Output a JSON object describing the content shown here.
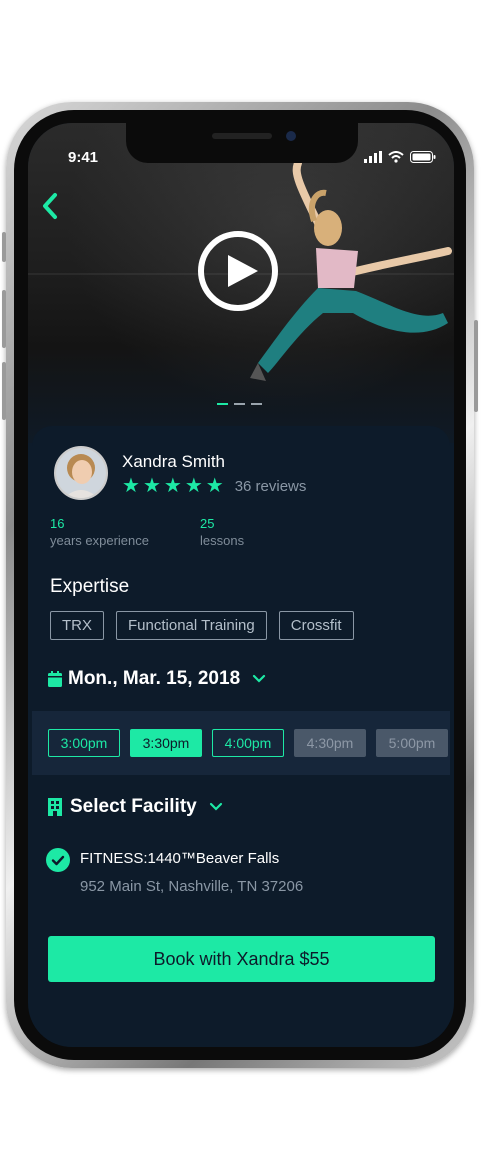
{
  "status_bar": {
    "time": "9:41"
  },
  "hero": {
    "slides": 3,
    "active_slide": 1
  },
  "trainer": {
    "name": "Xandra Smith",
    "rating": 5,
    "reviews_label": "36 reviews",
    "stats": [
      {
        "value": "16",
        "label": "years experience"
      },
      {
        "value": "25",
        "label": "lessons"
      }
    ]
  },
  "expertise": {
    "title": "Expertise",
    "tags": [
      "TRX",
      "Functional Training",
      "Crossfit"
    ]
  },
  "date_selector": {
    "value": "Mon., Mar. 15, 2018"
  },
  "time_slots": [
    {
      "label": "3:00pm",
      "state": "available"
    },
    {
      "label": "3:30pm",
      "state": "selected"
    },
    {
      "label": "4:00pm",
      "state": "available"
    },
    {
      "label": "4:30pm",
      "state": "disabled"
    },
    {
      "label": "5:00pm",
      "state": "disabled"
    }
  ],
  "facility": {
    "selector_label": "Select Facility",
    "name": "FITNESS:1440™Beaver Falls",
    "address": "952 Main St, Nashville, TN 37206"
  },
  "book_button": {
    "label": "Book with Xandra $55"
  },
  "colors": {
    "accent": "#1de9a5",
    "background": "#0d1b2a",
    "time_bar": "#16263a",
    "disabled": "#4a5869"
  },
  "icons": [
    "back-icon",
    "play-icon",
    "star-icon",
    "calendar-icon",
    "chevron-down-icon",
    "building-icon",
    "check-icon",
    "signal-icon",
    "wifi-icon",
    "battery-icon"
  ]
}
